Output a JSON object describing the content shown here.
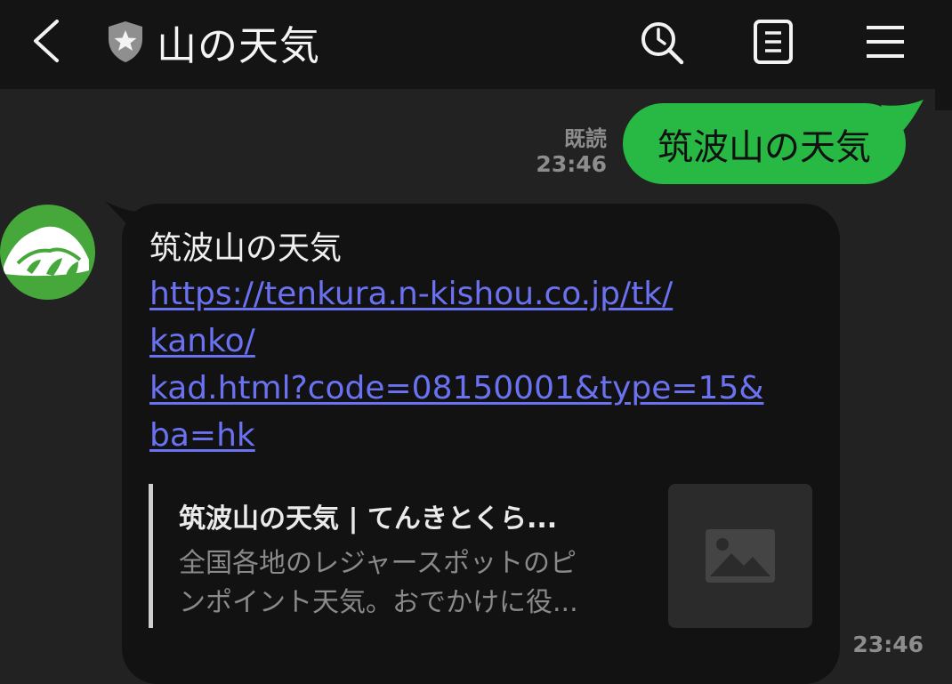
{
  "header": {
    "title": "山の天気",
    "icons": [
      "back-icon",
      "shield-star-icon",
      "search-icon",
      "notes-icon",
      "menu-icon"
    ]
  },
  "messages": {
    "outgoing": {
      "text": "筑波山の天気",
      "read_label": "既読",
      "time": "23:46"
    },
    "incoming": {
      "text": "筑波山の天気",
      "link_lines": [
        "https://tenkura.n-kishou.co.jp/tk/",
        "kanko/",
        "kad.html?code=08150001&type=15&",
        "ba=hk"
      ],
      "preview": {
        "title": "筑波山の天気 | てんきとくら...",
        "desc_lines": [
          "全国各地のレジャースポットのピ",
          "ンポイント天気。おでかけに役..."
        ],
        "thumbnail_icon": "image-placeholder-icon"
      },
      "time": "23:46"
    }
  },
  "colors": {
    "background": "#222222",
    "header": "#141414",
    "outgoing_bubble": "#28b844",
    "incoming_bubble": "#121212",
    "link": "#6a72f2",
    "avatar": "#46a83b"
  }
}
